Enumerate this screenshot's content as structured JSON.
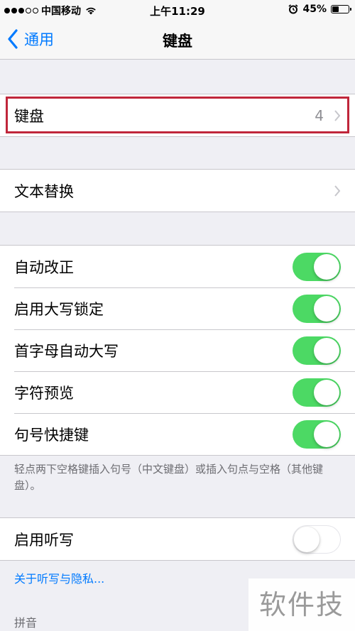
{
  "status_bar": {
    "carrier": "中国移动",
    "time": "上午11:29",
    "battery_text": "45%",
    "battery_level": 0.45
  },
  "nav": {
    "back_label": "通用",
    "title": "键盘"
  },
  "keyboards_row": {
    "label": "键盘",
    "count": "4"
  },
  "text_replacement_row": {
    "label": "文本替换"
  },
  "toggles": [
    {
      "label": "自动改正",
      "on": true
    },
    {
      "label": "启用大写锁定",
      "on": true
    },
    {
      "label": "首字母自动大写",
      "on": true
    },
    {
      "label": "字符预览",
      "on": true
    },
    {
      "label": "句号快捷键",
      "on": true
    }
  ],
  "footer_note": "轻点两下空格键插入句号（中文键盘）或插入句点与空格（其他键盘）。",
  "dictation_row": {
    "label": "启用听写",
    "on": false
  },
  "privacy_link": "关于听写与隐私...",
  "section_header": "拼音",
  "watermark_text": "软件技巧",
  "colors": {
    "accent": "#007aff",
    "toggle_on": "#4cd964",
    "highlight": "#c0263a"
  }
}
